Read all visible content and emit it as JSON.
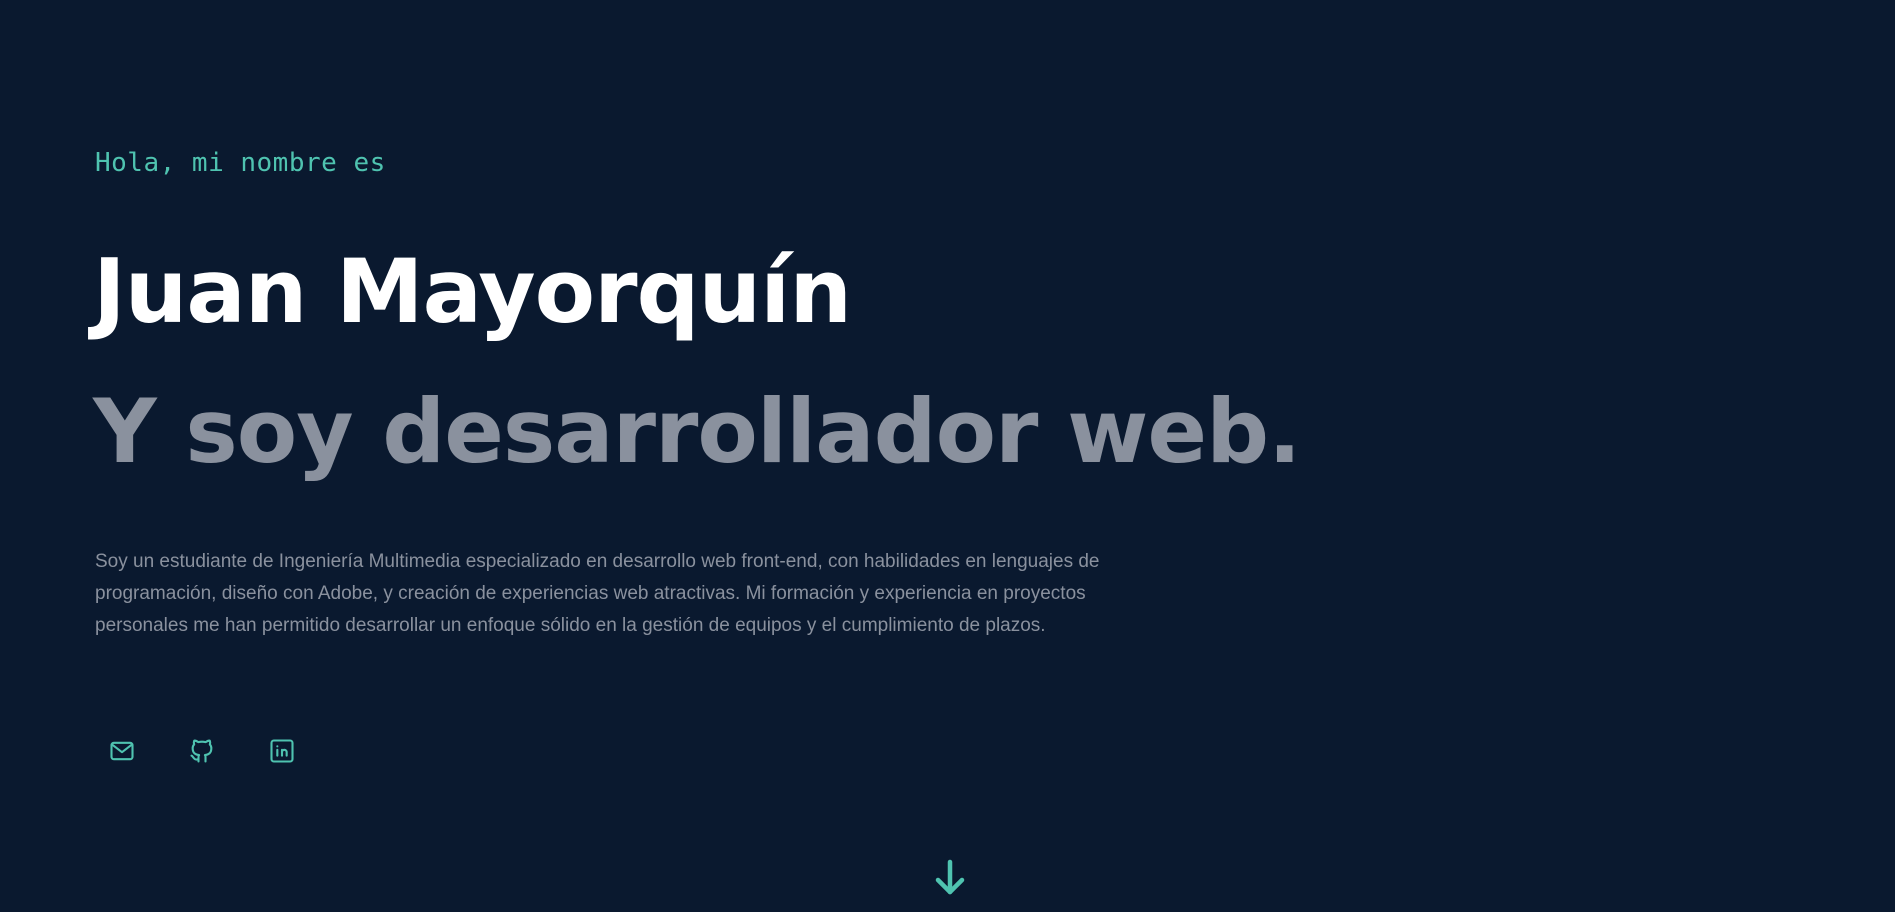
{
  "hero": {
    "greeting": "Hola, mi nombre es",
    "name": "Juan Mayorquín",
    "role": "Y soy desarrollador web.",
    "bio": "Soy un estudiante de Ingeniería Multimedia especializado en desarrollo web front-end, con habilidades en lenguajes de programación, diseño con Adobe, y creación de experiencias web atractivas. Mi formación y experiencia en proyectos personales me han permitido desarrollar un enfoque sólido en la gestión de equipos y el cumplimiento de plazos."
  },
  "socials": [
    {
      "icon": "mail-icon"
    },
    {
      "icon": "github-icon"
    },
    {
      "icon": "linkedin-icon"
    }
  ],
  "scroll": {
    "icon": "arrow-down-icon"
  },
  "colors": {
    "background": "#0a192f",
    "accent": "#4fc3b0",
    "heading": "#ffffff",
    "muted": "#8a919e"
  }
}
